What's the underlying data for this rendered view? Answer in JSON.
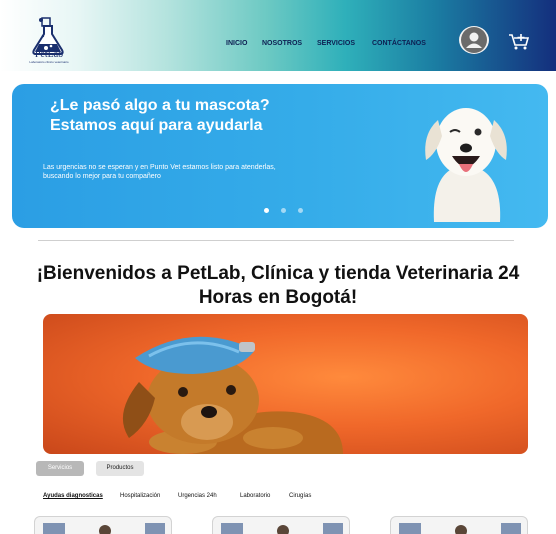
{
  "header": {
    "logo_text": "PetLab",
    "logo_tagline": "Laboratorio clinico veterinario",
    "nav": [
      "INICIO",
      "NOSOTROS",
      "SERVICIOS",
      "CONTÁCTANOS"
    ],
    "colors": {
      "brand_dark": "#142f7d",
      "accent_teal": "#2fb0ba"
    }
  },
  "hero": {
    "title": "¿Le pasó algo a tu mascota? Estamos aquí para ayudarla",
    "text": "Las urgencias no se esperan y en Punto Vet estamos listo para atenderlas, buscando lo mejor para tu compañero",
    "dots": [
      {
        "label": "slide-1",
        "active": true
      },
      {
        "label": "slide-2",
        "active": false
      },
      {
        "label": "slide-3",
        "active": false
      }
    ]
  },
  "welcome": {
    "title": "¡Bienvenidos a PetLab, Clínica y tienda  Veterinaria 24 Horas en Bogotá!"
  },
  "tabs": {
    "pills": [
      "Servicios",
      "Productos"
    ],
    "active_pill": "Servicios",
    "subtabs": [
      "Ayudas diagnosticas",
      "Hospitalización",
      "Urgencias 24h",
      "Laboratorio",
      "Cirugías"
    ],
    "active_subtab": "Ayudas diagnosticas"
  },
  "cards": [
    {
      "icon": "clinic-photo"
    },
    {
      "icon": "clinic-photo"
    },
    {
      "icon": "clinic-photo"
    }
  ]
}
